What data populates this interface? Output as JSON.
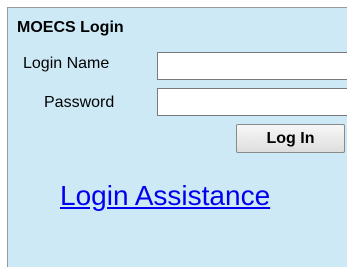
{
  "login": {
    "title": "MOECS Login",
    "username_label": "Login Name",
    "username_value": "",
    "password_label": "Password",
    "password_value": "",
    "login_button": "Log In",
    "assistance_link": "Login Assistance"
  }
}
